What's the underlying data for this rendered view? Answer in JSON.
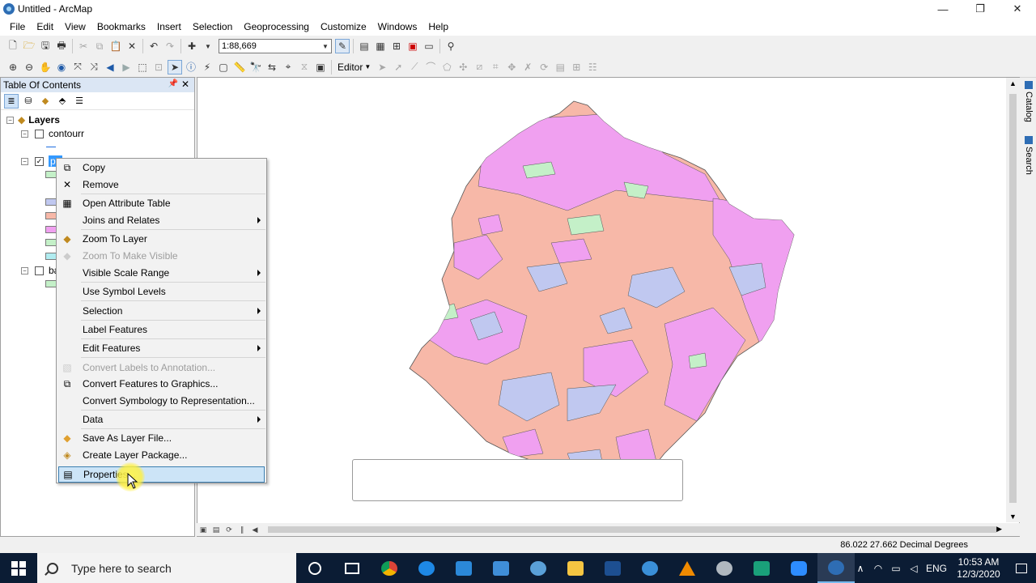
{
  "window": {
    "title": "Untitled - ArcMap",
    "minimize": "—",
    "maximize": "❐",
    "close": "✕"
  },
  "menu": [
    "File",
    "Edit",
    "View",
    "Bookmarks",
    "Insert",
    "Selection",
    "Geoprocessing",
    "Customize",
    "Windows",
    "Help"
  ],
  "toolbar": {
    "scale": "1:88,669",
    "editor": "Editor"
  },
  "toc": {
    "title": "Table Of Contents",
    "root": "Layers",
    "layers": [
      {
        "name": "contourr",
        "checked": false,
        "expanded": true
      },
      {
        "name": "po",
        "checked": true,
        "expanded": true,
        "selected": true
      },
      {
        "name": "ba",
        "checked": false,
        "expanded": true
      }
    ],
    "swatch_colors": [
      "#c4f0c8",
      "#c0c8f0",
      "#f7b8a8",
      "#f0a0f0",
      "#c4f0c8",
      "#b0ecf0",
      "#c4f0c8"
    ]
  },
  "context_menu": {
    "items": [
      {
        "label": "Copy",
        "icon": "copy-icon",
        "enabled": true,
        "submenu": false
      },
      {
        "label": "Remove",
        "icon": "remove-icon",
        "enabled": true,
        "submenu": false
      },
      {
        "label": "Open Attribute Table",
        "icon": "table-icon",
        "enabled": true,
        "submenu": false
      },
      {
        "label": "Joins and Relates",
        "icon": "",
        "enabled": true,
        "submenu": true
      },
      {
        "label": "Zoom To Layer",
        "icon": "zoom-layer-icon",
        "enabled": true,
        "submenu": false
      },
      {
        "label": "Zoom To Make Visible",
        "icon": "zoom-visible-icon",
        "enabled": false,
        "submenu": false
      },
      {
        "label": "Visible Scale Range",
        "icon": "",
        "enabled": true,
        "submenu": true
      },
      {
        "label": "Use Symbol Levels",
        "icon": "",
        "enabled": true,
        "submenu": false
      },
      {
        "label": "Selection",
        "icon": "",
        "enabled": true,
        "submenu": true
      },
      {
        "label": "Label Features",
        "icon": "",
        "enabled": true,
        "submenu": false
      },
      {
        "label": "Edit Features",
        "icon": "",
        "enabled": true,
        "submenu": true
      },
      {
        "label": "Convert Labels to Annotation...",
        "icon": "convert-labels-icon",
        "enabled": false,
        "submenu": false
      },
      {
        "label": "Convert Features to Graphics...",
        "icon": "convert-graphics-icon",
        "enabled": true,
        "submenu": false
      },
      {
        "label": "Convert Symbology to Representation...",
        "icon": "",
        "enabled": true,
        "submenu": false
      },
      {
        "label": "Data",
        "icon": "",
        "enabled": true,
        "submenu": true
      },
      {
        "label": "Save As Layer File...",
        "icon": "layer-file-icon",
        "enabled": true,
        "submenu": false
      },
      {
        "label": "Create Layer Package...",
        "icon": "layer-package-icon",
        "enabled": true,
        "submenu": false
      },
      {
        "label": "Properties...",
        "icon": "properties-icon",
        "enabled": true,
        "submenu": false,
        "highlighted": true
      }
    ]
  },
  "side_tabs": [
    "Catalog",
    "Search"
  ],
  "status": {
    "coords": "86.022  27.662 Decimal Degrees"
  },
  "taskbar": {
    "search_placeholder": "Type here to search",
    "language": "ENG",
    "time": "10:53 AM",
    "date": "12/3/2020"
  },
  "colors": {
    "accent": "#3399ff",
    "map_salmon": "#f7b8a8",
    "map_magenta": "#f0a0f0",
    "map_blue": "#c0c8f0",
    "map_green": "#c4f0c8"
  }
}
